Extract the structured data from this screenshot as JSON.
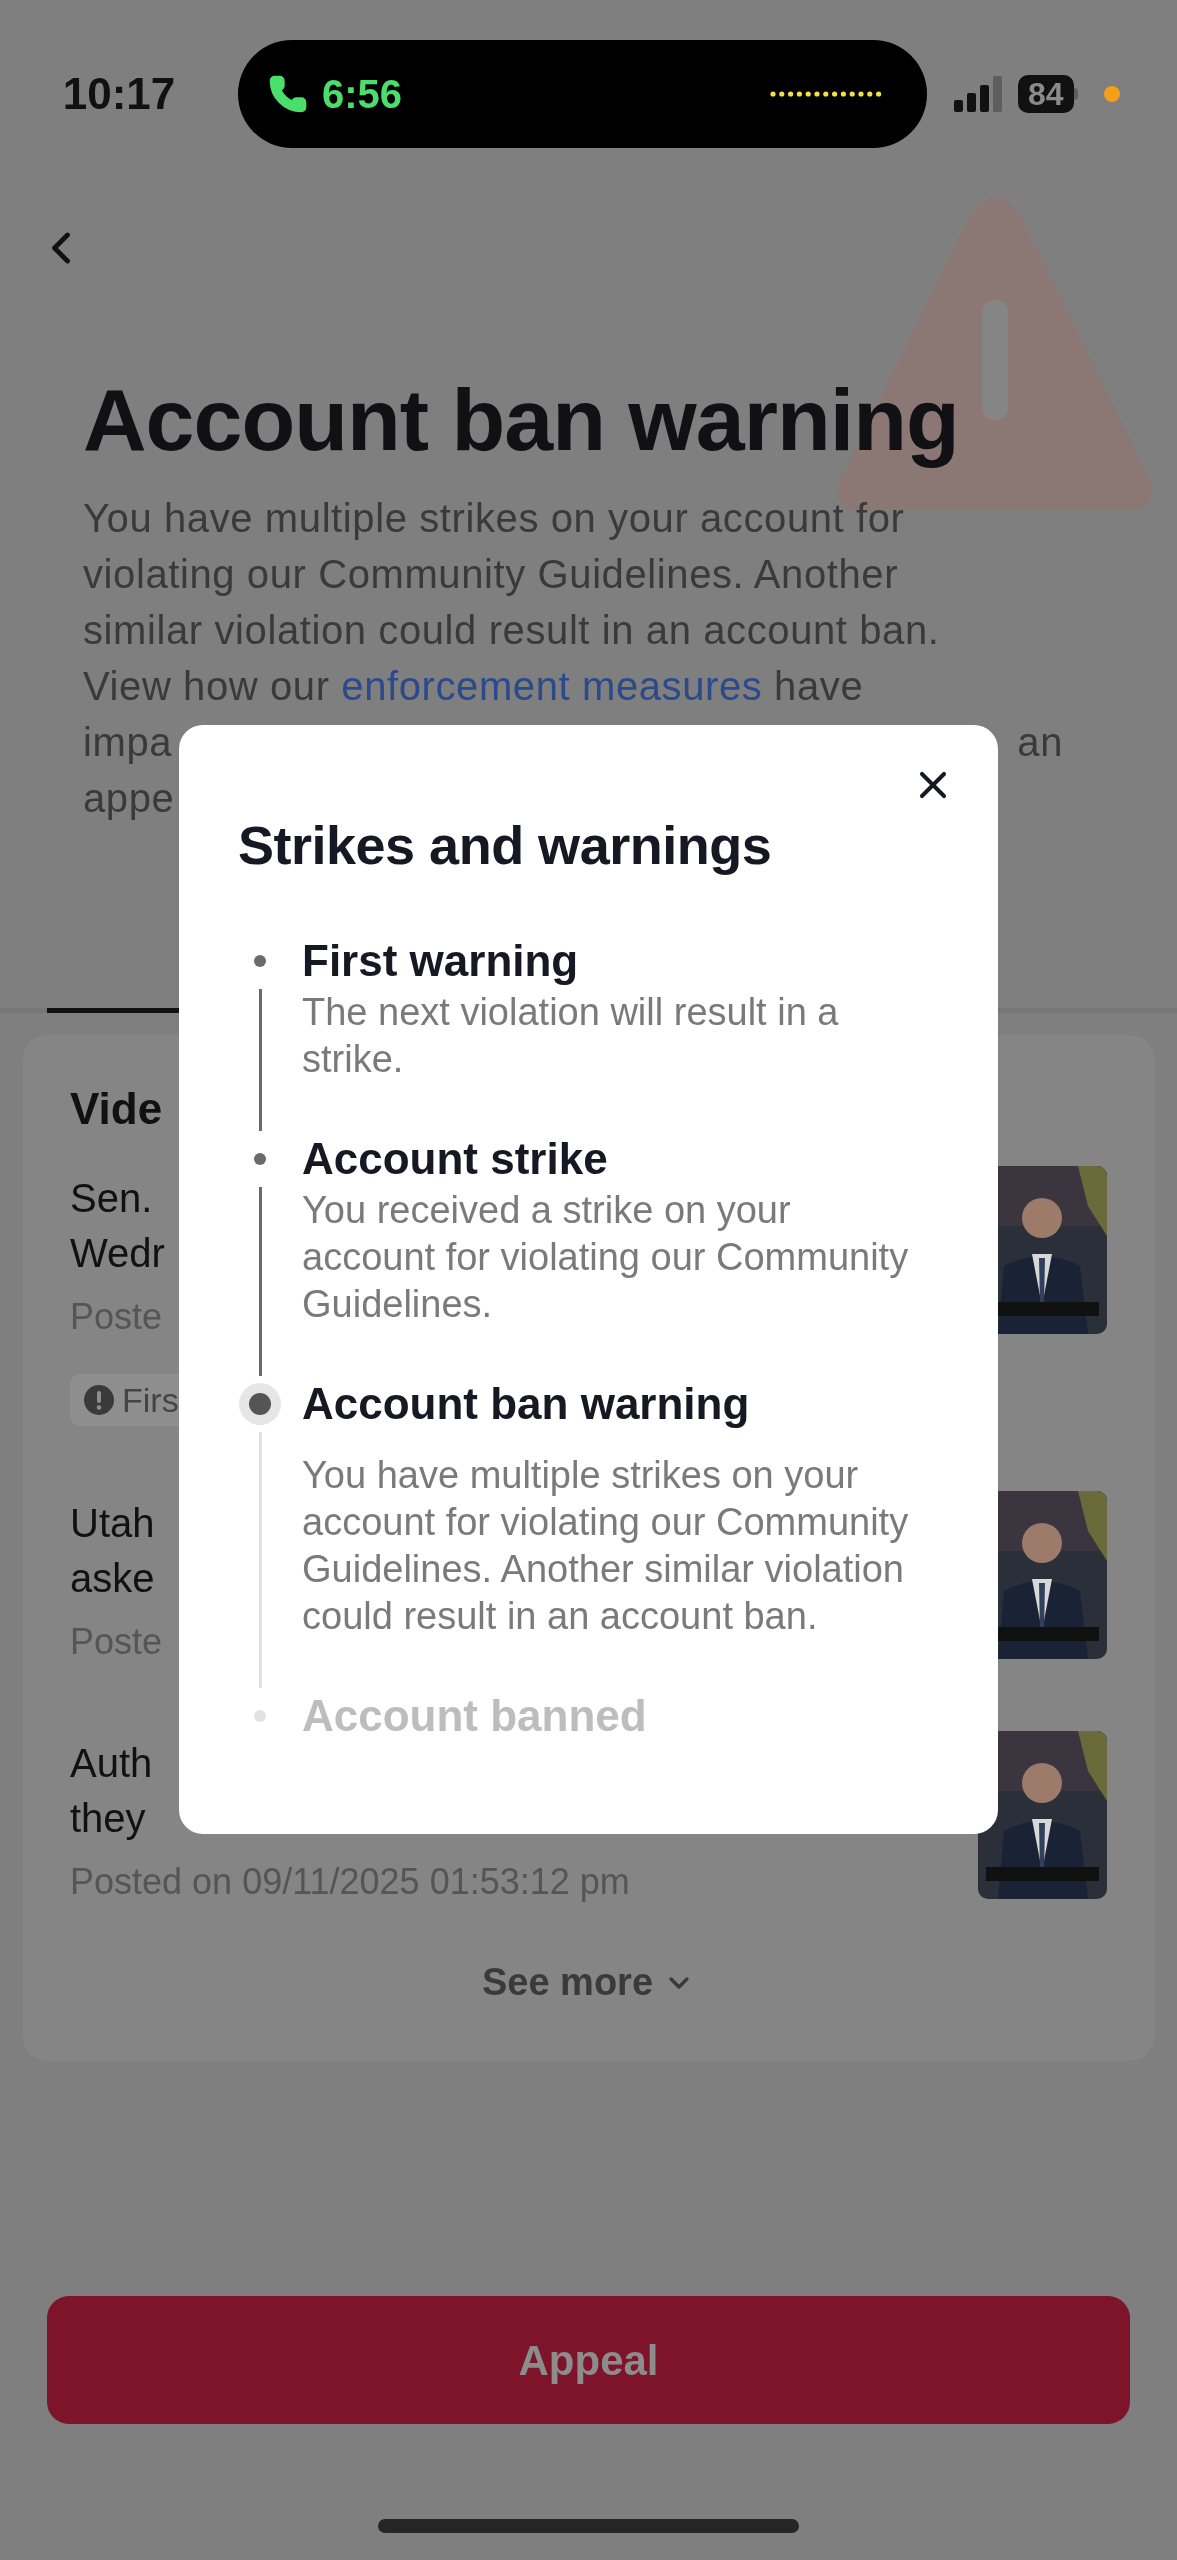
{
  "status_bar": {
    "time": "10:17",
    "call_timer": "6:56",
    "battery": "84"
  },
  "page": {
    "title": "Account ban warning",
    "intro": {
      "lines": [
        "You have multiple strikes on your account for",
        "violating our Community Guidelines. Another",
        "similar violation could result in an account ban."
      ],
      "last_line": {
        "before": "View how our ",
        "link": "enforcement measures",
        "after": " have"
      }
    },
    "intro_cut_lines": [
      {
        "left": "impa",
        "right": "an"
      },
      {
        "left": "appe"
      }
    ]
  },
  "videos": {
    "heading": "Vide",
    "items": [
      {
        "title_lines": [
          "Sen.",
          "Wedr"
        ],
        "posted": "Poste",
        "badge": "Firs"
      },
      {
        "title_lines": [
          "Utah",
          "aske"
        ],
        "posted": "Poste"
      },
      {
        "title_lines": [
          "Auth",
          "they"
        ],
        "posted": "Posted on 09/11/2025 01:53:12 pm"
      }
    ],
    "see_more": "See more"
  },
  "appeal_button": "Appeal",
  "dialog": {
    "title": "Strikes and warnings",
    "steps": [
      {
        "title": "First warning",
        "description": "The next violation will result in a strike.",
        "kind": "past"
      },
      {
        "title": "Account strike",
        "description": "You received a strike on your account for violating our Community Guidelines.",
        "kind": "past"
      },
      {
        "title": "Account ban warning",
        "description": "You have multiple strikes on your account for violating our Community Guidelines. Another similar violation could result in an account ban.",
        "kind": "current"
      },
      {
        "title": "Account banned",
        "kind": "future"
      }
    ]
  }
}
